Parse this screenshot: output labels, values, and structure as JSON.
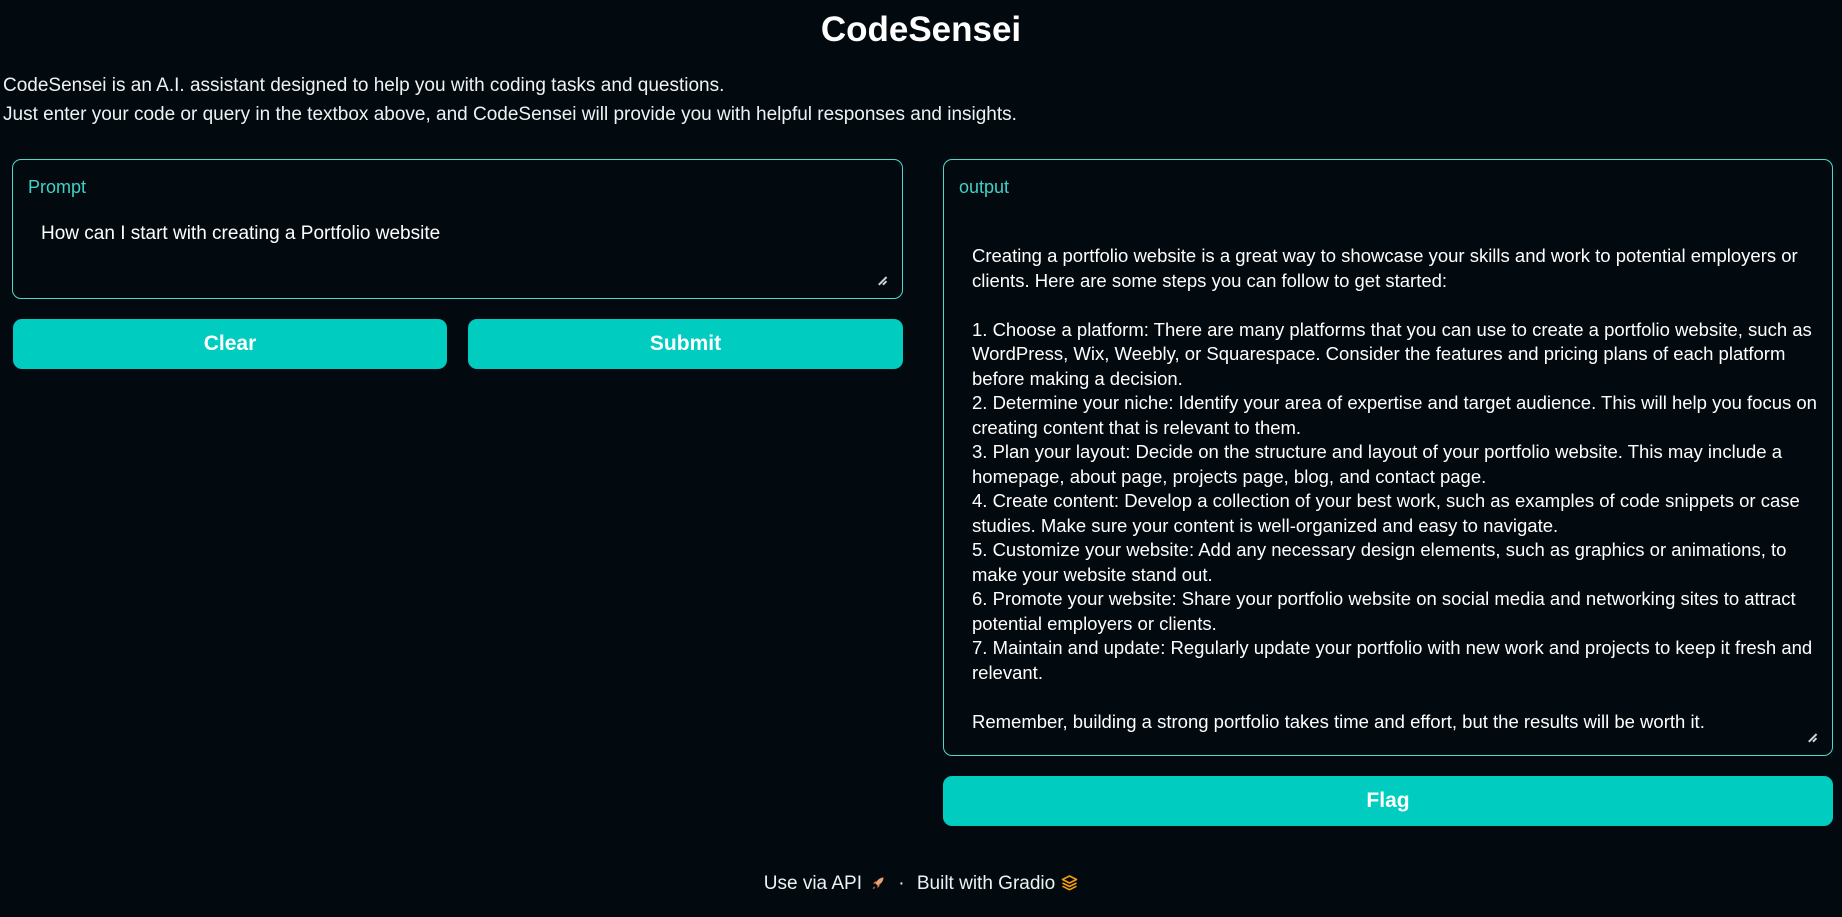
{
  "app": {
    "title": "CodeSensei",
    "description_line1": "CodeSensei is an A.I. assistant designed to help you with coding tasks and questions.",
    "description_line2": "Just enter your code or query in the textbox above, and CodeSensei will provide you with helpful responses and insights."
  },
  "prompt": {
    "label": "Prompt",
    "value": "How can I start with creating a Portfolio website"
  },
  "buttons": {
    "clear_label": "Clear",
    "submit_label": "Submit",
    "flag_label": "Flag"
  },
  "output": {
    "label": "output",
    "value": "Creating a portfolio website is a great way to showcase your skills and work to potential employers or clients. Here are some steps you can follow to get started:\n\n1. Choose a platform: There are many platforms that you can use to create a portfolio website, such as WordPress, Wix, Weebly, or Squarespace. Consider the features and pricing plans of each platform before making a decision.\n2. Determine your niche: Identify your area of expertise and target audience. This will help you focus on creating content that is relevant to them.\n3. Plan your layout: Decide on the structure and layout of your portfolio website. This may include a homepage, about page, projects page, blog, and contact page.\n4. Create content: Develop a collection of your best work, such as examples of code snippets or case studies. Make sure your content is well-organized and easy to navigate.\n5. Customize your website: Add any necessary design elements, such as graphics or animations, to make your website stand out.\n6. Promote your website: Share your portfolio website on social media and networking sites to attract potential employers or clients.\n7. Maintain and update: Regularly update your portfolio with new work and projects to keep it fresh and relevant.\n\nRemember, building a strong portfolio takes time and effort, but the results will be worth it."
  },
  "footer": {
    "api_link": "Use via API",
    "separator": "·",
    "built_with": "Built with Gradio",
    "icons": [
      "rocket-icon",
      "gradio-logo-icon"
    ]
  },
  "colors": {
    "background": "#030a0f",
    "accent": "#00ccbf",
    "border": "#4fd7cb",
    "label": "#3fd2c7"
  }
}
